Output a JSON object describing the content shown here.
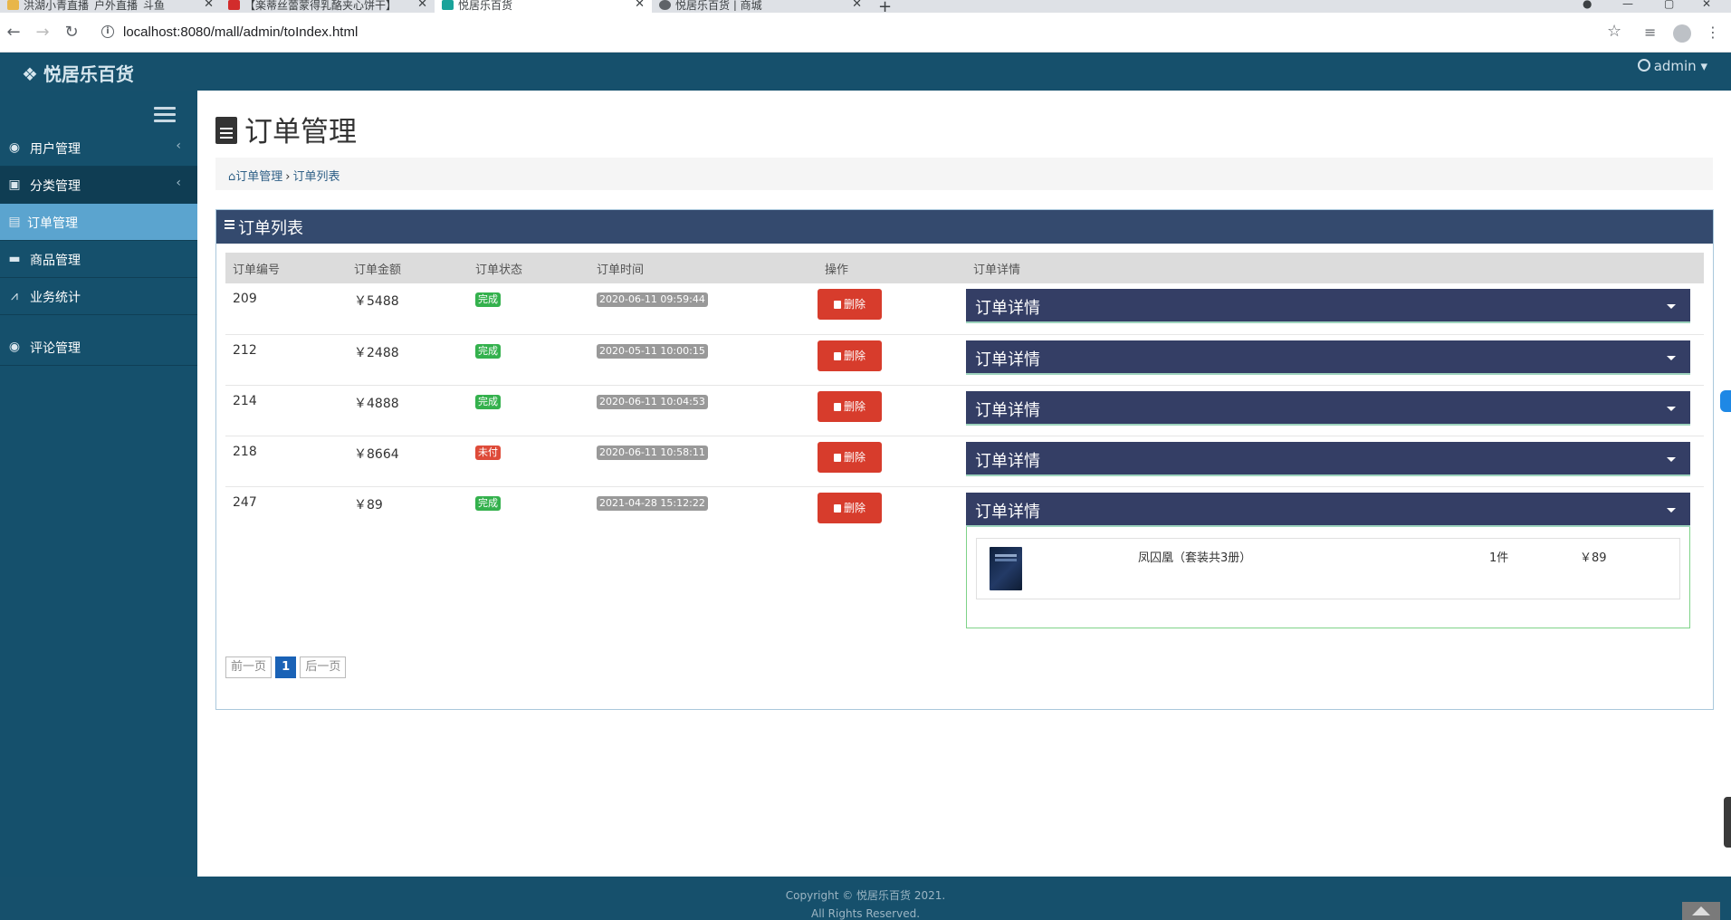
{
  "browser": {
    "tabs": [
      {
        "title": "洪湖小青直播_户外直播_斗鱼"
      },
      {
        "title": "【楽蒂丝蕾蒙得乳酪夹心饼干】"
      },
      {
        "title": "悦居乐百货"
      },
      {
        "title": "悦居乐百货 | 商城"
      }
    ],
    "url": "localhost:8080/mall/admin/toIndex.html"
  },
  "header": {
    "brand": "悦居乐百货",
    "user": "admin"
  },
  "sidebar": {
    "items": [
      {
        "label": "用户管理"
      },
      {
        "label": "分类管理"
      },
      {
        "label": "订单管理"
      },
      {
        "label": "商品管理"
      },
      {
        "label": "业务统计"
      },
      {
        "label": "评论管理"
      }
    ]
  },
  "page": {
    "title": "订单管理",
    "breadcrumb": [
      "订单管理",
      "订单列表"
    ],
    "panel_title": "订单列表"
  },
  "table": {
    "columns": [
      "订单编号",
      "订单金额",
      "订单状态",
      "订单时间",
      "操作",
      "订单详情"
    ],
    "delete_label": "删除",
    "detail_label": "订单详情",
    "rows": [
      {
        "id": "209",
        "amount": "￥5488",
        "status": "完成",
        "status_type": "done",
        "time": "2020-06-11 09:59:44"
      },
      {
        "id": "212",
        "amount": "￥2488",
        "status": "完成",
        "status_type": "done",
        "time": "2020-05-11 10:00:15"
      },
      {
        "id": "214",
        "amount": "￥4888",
        "status": "完成",
        "status_type": "done",
        "time": "2020-06-11 10:04:53"
      },
      {
        "id": "218",
        "amount": "￥8664",
        "status": "未付",
        "status_type": "unpaid",
        "time": "2020-06-11 10:58:11"
      },
      {
        "id": "247",
        "amount": "￥89",
        "status": "完成",
        "status_type": "done",
        "time": "2021-04-28 15:12:22"
      }
    ],
    "expanded_item": {
      "name": "凤囚凰（套装共3册）",
      "qty": "1件",
      "price": "￥89"
    }
  },
  "pager": {
    "prev": "前一页",
    "current": "1",
    "next": "后一页"
  },
  "footer": {
    "line1": "Copyright © 悦居乐百货 2021.",
    "line2": "All Rights Reserved."
  },
  "colors": {
    "header": "#16506c",
    "sidebar": "#15506c",
    "active_item": "#5ba4cf",
    "panel_head": "#344a6e",
    "detail_bar": "#343e65",
    "delete": "#d73c2c",
    "done": "#34b14d",
    "unpaid": "#de4b39"
  }
}
